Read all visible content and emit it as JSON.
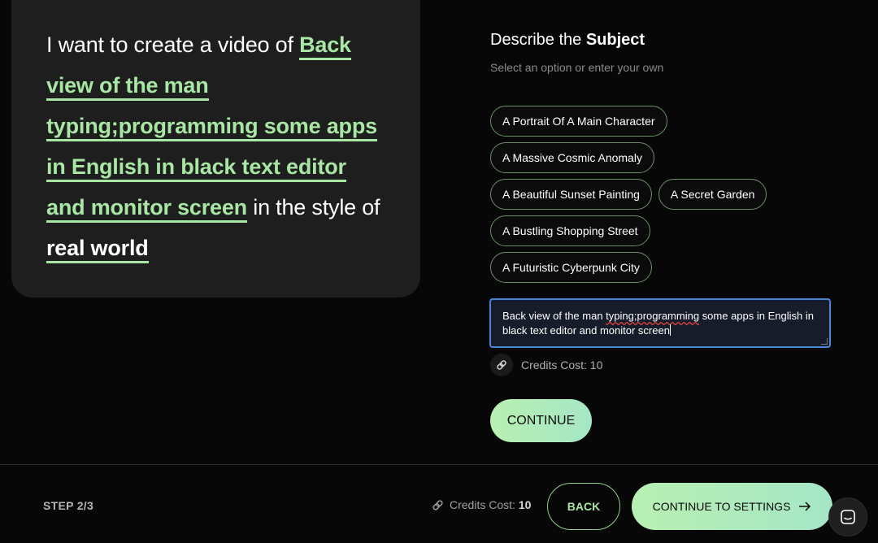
{
  "prompt": {
    "lead": "I want to create a video of ",
    "subject": "Back view of the man typing;programming some apps in English in black text editor and monitor screen",
    "middle": " in the style of ",
    "style": "real world"
  },
  "panel": {
    "title_prefix": "Describe the ",
    "title_bold": "Subject",
    "subtitle": "Select an option or enter your own"
  },
  "options": [
    "A Portrait Of A Main Character",
    "A Massive Cosmic Anomaly",
    "A Beautiful Sunset Painting",
    "A Secret Garden",
    "A Bustling Shopping Street",
    "A Futuristic Cyberpunk City"
  ],
  "input": {
    "before": "Back view of the man ",
    "misspelled_1": "typing;programming",
    "after": " some apps in English in black text editor and monitor screen"
  },
  "credits": {
    "label": "Credits Cost: 10"
  },
  "continue_label": "CONTINUE",
  "footer": {
    "step": "STEP 2/3",
    "credits_label": "Credits Cost: ",
    "credits_value": "10",
    "back_label": "BACK",
    "settings_label": "CONTINUE TO SETTINGS"
  },
  "icons": {
    "credits": "link-coin-icon",
    "arrow": "arrow-right-icon",
    "chat": "chat-icon"
  },
  "colors": {
    "accent": "#a8e6a3",
    "focus_border": "#4a86d8",
    "background": "#070707",
    "card": "#1e1e1e"
  }
}
